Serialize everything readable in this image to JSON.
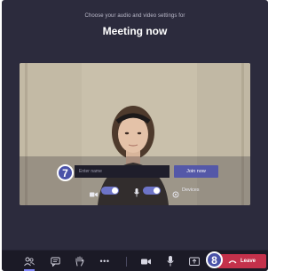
{
  "prejoin": {
    "subtitle": "Choose your audio and video settings for",
    "title": "Meeting now"
  },
  "join": {
    "name_placeholder": "Enter name",
    "join_label": "Join now"
  },
  "controls": {
    "camera_on": true,
    "mic_on": true,
    "devices_label": "Devices"
  },
  "toolbar": {
    "leave_label": "Leave",
    "more_label": "•••"
  },
  "callouts": {
    "name_field": "7",
    "leave": "8"
  },
  "colors": {
    "window_bg": "#2c2b3d",
    "toolbar_bg": "#1b1a26",
    "accent": "#6d74c8",
    "join_button": "#5458a8",
    "leave_button": "#c4314b",
    "callout_badge": "#4a52a8"
  }
}
